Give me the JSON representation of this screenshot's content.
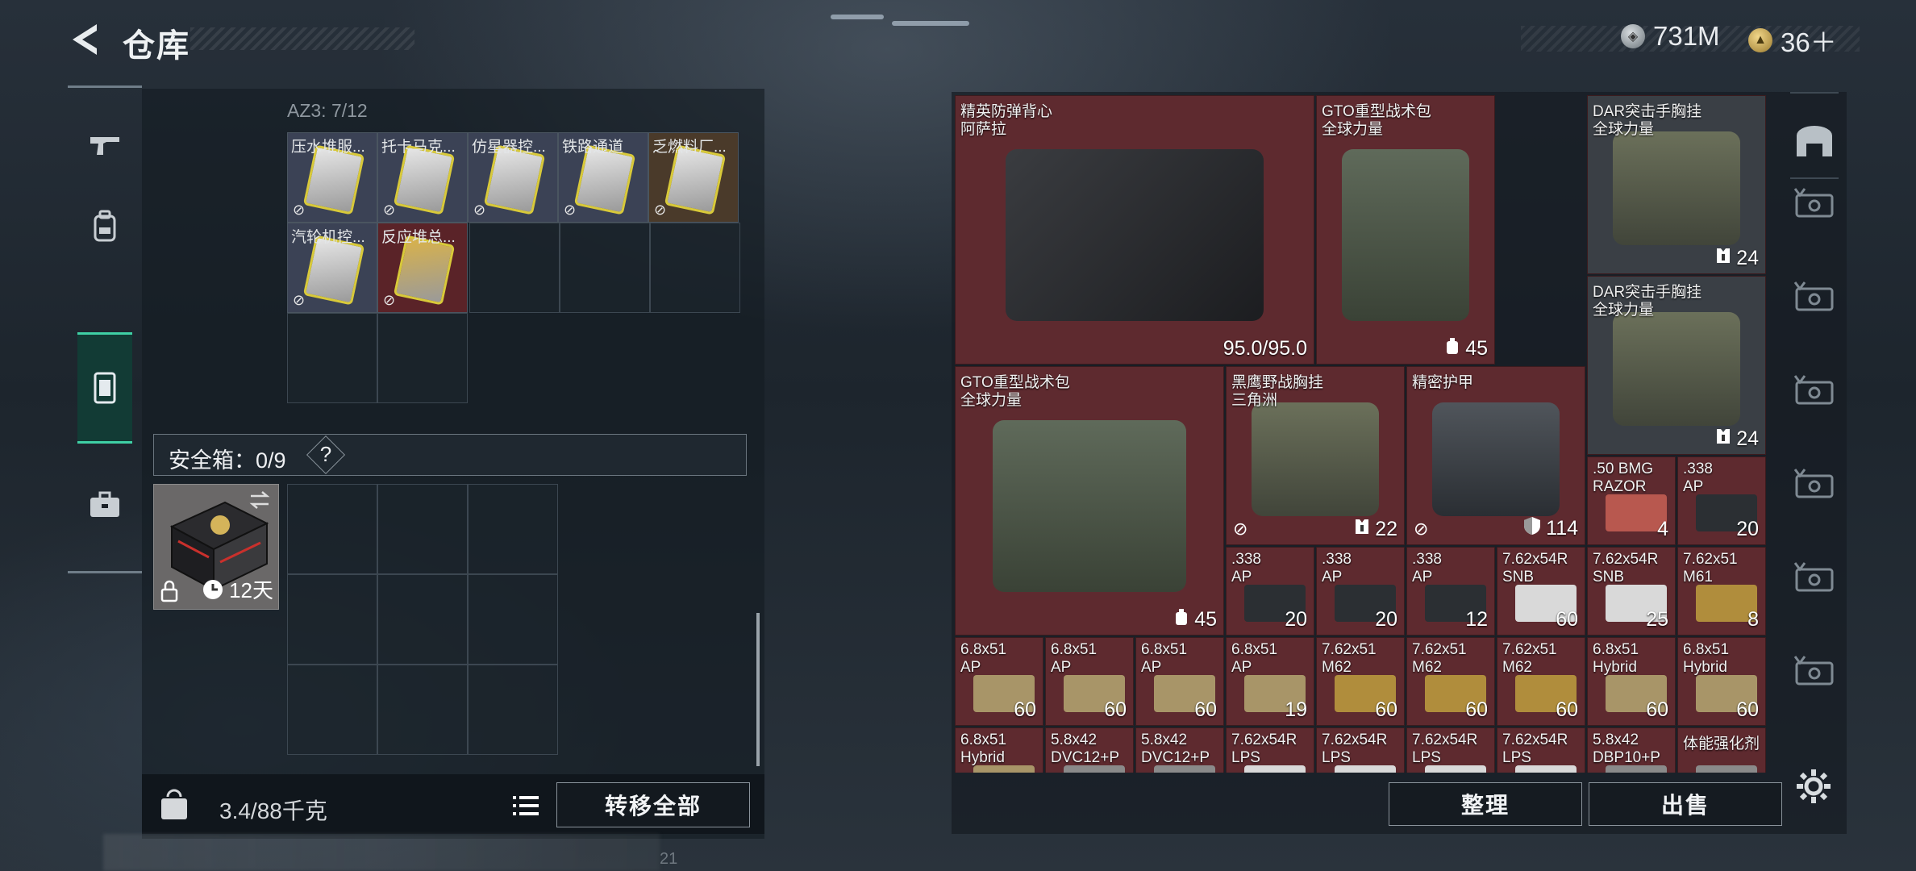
{
  "header": {
    "title": "仓库",
    "currency_silver": "731M",
    "currency_gold": "36＋"
  },
  "left_nav": {
    "items": [
      {
        "name": "weapons",
        "icon": "gun-icon"
      },
      {
        "name": "gear",
        "icon": "backpack-icon"
      },
      {
        "name": "rig",
        "icon": "vest-icon",
        "active": true
      },
      {
        "name": "items",
        "icon": "briefcase-icon"
      }
    ]
  },
  "container": {
    "label": "AZ3: 7/12",
    "items": [
      {
        "name": "压水堆服...",
        "color": "#e6e6e6"
      },
      {
        "name": "托卡马克...",
        "color": "#e6e6e6"
      },
      {
        "name": "仿星器控...",
        "color": "#e6e6e6"
      },
      {
        "name": "铁路通道",
        "color": "#e6e6e6"
      },
      {
        "name": "乏燃料厂...",
        "color": "#e6e6e6"
      },
      {
        "name": "汽轮机控...",
        "color": "#e6e6e6"
      },
      {
        "name": "反应堆总...",
        "color": "#d9b24a"
      }
    ]
  },
  "safebox": {
    "label": "安全箱：0/9",
    "help": "?",
    "duration": "12天"
  },
  "bottom": {
    "capacity": "3.4/88千克",
    "transfer_all": "转移全部",
    "page": "21"
  },
  "stash": {
    "items": [
      {
        "l1": "精英防弹背心",
        "l2": "阿萨拉",
        "count": "95.0/95.0",
        "icon": "",
        "bg": "red"
      },
      {
        "l1": "GTO重型战术包",
        "l2": "全球力量",
        "count": "45",
        "icon": "backpack-small-icon",
        "bg": "red"
      },
      {
        "l1": "DAR突击手胸挂",
        "l2": "全球力量",
        "count": "24",
        "icon": "rig-small-icon",
        "bg": "grey"
      },
      {
        "l1": "DAR突击手胸挂",
        "l2": "全球力量",
        "count": "24",
        "icon": "rig-small-icon",
        "bg": "grey"
      },
      {
        "l1": "GTO重型战术包",
        "l2": "全球力量",
        "count": "45",
        "icon": "backpack-small-icon",
        "bg": "red"
      },
      {
        "l1": "黑鹰野战胸挂",
        "l2": "三角洲",
        "count": "22",
        "icon": "rig-small-icon",
        "bg": "red"
      },
      {
        "l1": "精密护甲",
        "l2": "",
        "count": "114",
        "icon": "shield-small-icon",
        "bg": "red"
      },
      {
        "l1": ".50 BMG",
        "l2": "RAZOR",
        "count": "4",
        "icon": "",
        "bg": "red"
      },
      {
        "l1": ".338",
        "l2": "AP",
        "count": "20",
        "icon": "",
        "bg": "red"
      },
      {
        "l1": ".338",
        "l2": "AP",
        "count": "20",
        "icon": "",
        "bg": "red"
      },
      {
        "l1": ".338",
        "l2": "AP",
        "count": "20",
        "icon": "",
        "bg": "red"
      },
      {
        "l1": ".338",
        "l2": "AP",
        "count": "12",
        "icon": "",
        "bg": "red"
      },
      {
        "l1": "7.62x54R",
        "l2": "SNB",
        "count": "60",
        "icon": "",
        "bg": "red"
      },
      {
        "l1": "7.62x54R",
        "l2": "SNB",
        "count": "25",
        "icon": "",
        "bg": "red"
      },
      {
        "l1": "7.62x51",
        "l2": "M61",
        "count": "8",
        "icon": "",
        "bg": "red"
      },
      {
        "l1": "6.8x51",
        "l2": "AP",
        "count": "60",
        "icon": "",
        "bg": "red"
      },
      {
        "l1": "6.8x51",
        "l2": "AP",
        "count": "60",
        "icon": "",
        "bg": "red"
      },
      {
        "l1": "6.8x51",
        "l2": "AP",
        "count": "60",
        "icon": "",
        "bg": "red"
      },
      {
        "l1": "6.8x51",
        "l2": "AP",
        "count": "19",
        "icon": "",
        "bg": "red"
      },
      {
        "l1": "7.62x51",
        "l2": "M62",
        "count": "60",
        "icon": "",
        "bg": "red"
      },
      {
        "l1": "7.62x51",
        "l2": "M62",
        "count": "60",
        "icon": "",
        "bg": "red"
      },
      {
        "l1": "7.62x51",
        "l2": "M62",
        "count": "60",
        "icon": "",
        "bg": "red"
      },
      {
        "l1": "6.8x51",
        "l2": "Hybrid",
        "count": "60",
        "icon": "",
        "bg": "red"
      },
      {
        "l1": "6.8x51",
        "l2": "Hybrid",
        "count": "60",
        "icon": "",
        "bg": "red"
      },
      {
        "l1": "6.8x51",
        "l2": "Hybrid",
        "count": "",
        "icon": "",
        "bg": "red"
      },
      {
        "l1": "5.8x42",
        "l2": "DVC12+P",
        "count": "",
        "icon": "",
        "bg": "red"
      },
      {
        "l1": "5.8x42",
        "l2": "DVC12+P",
        "count": "",
        "icon": "",
        "bg": "red"
      },
      {
        "l1": "7.62x54R",
        "l2": "LPS",
        "count": "",
        "icon": "",
        "bg": "red"
      },
      {
        "l1": "7.62x54R",
        "l2": "LPS",
        "count": "",
        "icon": "",
        "bg": "red"
      },
      {
        "l1": "7.62x54R",
        "l2": "LPS",
        "count": "",
        "icon": "",
        "bg": "red"
      },
      {
        "l1": "7.62x54R",
        "l2": "LPS",
        "count": "",
        "icon": "",
        "bg": "red"
      },
      {
        "l1": "5.8x42",
        "l2": "DBP10+P",
        "count": "",
        "icon": "",
        "bg": "red"
      },
      {
        "l1": "体能强化剂",
        "l2": "",
        "count": "",
        "icon": "",
        "bg": "red"
      }
    ],
    "organize": "整理",
    "sell": "出售"
  }
}
